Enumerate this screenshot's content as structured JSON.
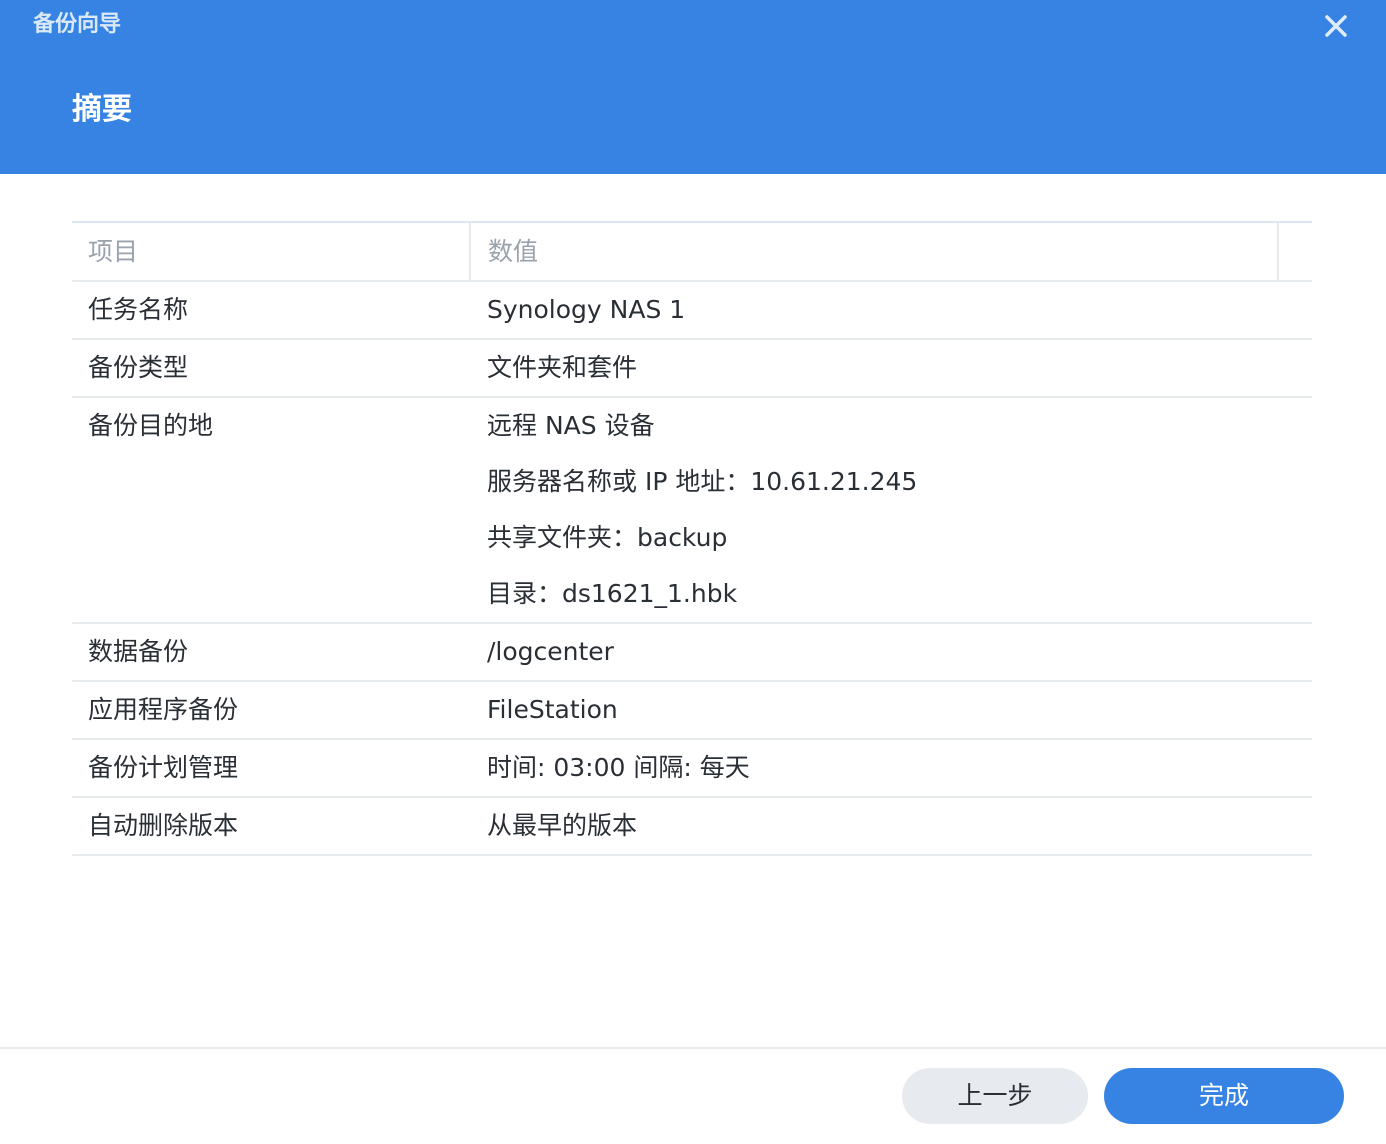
{
  "window": {
    "title": "备份向导",
    "step_title": "摘要",
    "close_icon": "close-icon"
  },
  "table": {
    "columns": [
      "项目",
      "数值"
    ],
    "rows": [
      {
        "label": "任务名称",
        "values": [
          "Synology NAS 1"
        ]
      },
      {
        "label": "备份类型",
        "values": [
          "文件夹和套件"
        ]
      },
      {
        "label": "备份目的地",
        "values": [
          "远程 NAS 设备",
          "服务器名称或 IP 地址：10.61.21.245",
          "共享文件夹：backup",
          "目录：ds1621_1.hbk"
        ]
      },
      {
        "label": "数据备份",
        "values": [
          "/logcenter"
        ]
      },
      {
        "label": "应用程序备份",
        "values": [
          "FileStation"
        ]
      },
      {
        "label": "备份计划管理",
        "values": [
          "时间: 03:00 间隔: 每天"
        ]
      },
      {
        "label": "自动删除版本",
        "values": [
          "从最早的版本"
        ]
      }
    ]
  },
  "buttons": {
    "back": "上一步",
    "finish": "完成"
  },
  "colors": {
    "accent": "#3683e3",
    "text": "#2a2f36",
    "header_text": "#9aa2ad",
    "secondary_button": "#e7ebf0"
  }
}
